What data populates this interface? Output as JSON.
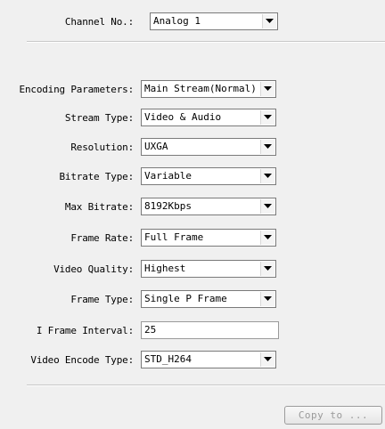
{
  "channel": {
    "label": "Channel No.:",
    "value": "Analog 1"
  },
  "encoding_parameters": {
    "label": "Encoding Parameters:",
    "value": "Main Stream(Normal)"
  },
  "stream_type": {
    "label": "Stream Type:",
    "value": "Video & Audio"
  },
  "resolution": {
    "label": "Resolution:",
    "value": "UXGA"
  },
  "bitrate_type": {
    "label": "Bitrate Type:",
    "value": "Variable"
  },
  "max_bitrate": {
    "label": "Max Bitrate:",
    "value": "8192Kbps"
  },
  "frame_rate": {
    "label": "Frame Rate:",
    "value": "Full Frame"
  },
  "video_quality": {
    "label": "Video Quality:",
    "value": "Highest"
  },
  "frame_type": {
    "label": "Frame Type:",
    "value": "Single P Frame"
  },
  "i_frame_interval": {
    "label": "I Frame Interval:",
    "value": "25"
  },
  "video_encode_type": {
    "label": "Video Encode Type:",
    "value": "STD_H264"
  },
  "copy_button": {
    "label": "Copy to ..."
  }
}
